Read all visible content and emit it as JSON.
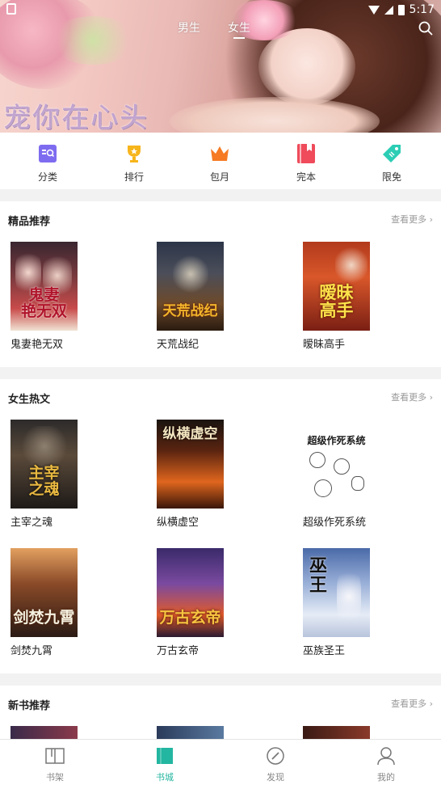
{
  "status_bar": {
    "time": "5:17"
  },
  "banner": {
    "title": "宠你在心头"
  },
  "top_tabs": [
    {
      "label": "男生"
    },
    {
      "label": "女生"
    }
  ],
  "categories": [
    {
      "label": "分类",
      "icon": "category-icon",
      "color": "#7e6cf0"
    },
    {
      "label": "排行",
      "icon": "trophy-icon",
      "color": "#f7b51c"
    },
    {
      "label": "包月",
      "icon": "crown-icon",
      "color": "#f57a23"
    },
    {
      "label": "完本",
      "icon": "bookmark-icon",
      "color": "#ef4b5b"
    },
    {
      "label": "限免",
      "icon": "tag-icon",
      "color": "#2ccdb5"
    }
  ],
  "sections": {
    "featured": {
      "title": "精品推荐",
      "more": "查看更多",
      "books": [
        {
          "title": "鬼妻艳无双"
        },
        {
          "title": "天荒战纪"
        },
        {
          "title": "暧昧高手"
        }
      ]
    },
    "female_hot": {
      "title": "女生热文",
      "more": "查看更多",
      "books": [
        {
          "title": "主宰之魂"
        },
        {
          "title": "纵横虚空"
        },
        {
          "title": "超级作死系统"
        },
        {
          "title": "剑焚九霄"
        },
        {
          "title": "万古玄帝"
        },
        {
          "title": "巫族圣王"
        }
      ]
    },
    "new_books": {
      "title": "新书推荐",
      "more": "查看更多"
    }
  },
  "bottom_nav": [
    {
      "label": "书架",
      "icon": "bookshelf-icon"
    },
    {
      "label": "书城",
      "icon": "bookstore-icon",
      "active": true
    },
    {
      "label": "发现",
      "icon": "compass-icon"
    },
    {
      "label": "我的",
      "icon": "user-icon"
    }
  ],
  "colors": {
    "accent": "#23b6a0"
  }
}
